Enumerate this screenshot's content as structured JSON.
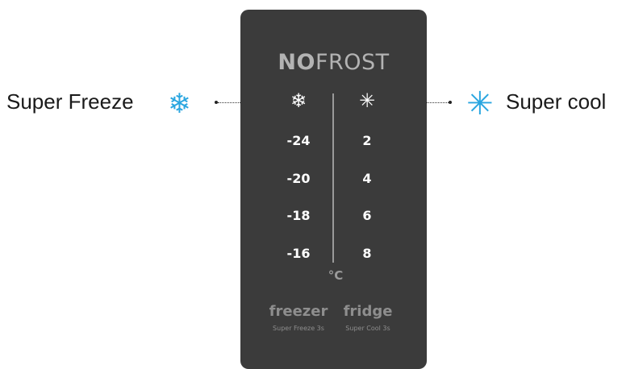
{
  "brand": {
    "bold": "NO",
    "light": "FROST"
  },
  "freezer": {
    "temps": [
      "-24",
      "-20",
      "-18",
      "-16"
    ],
    "name": "freezer",
    "sub": "Super Freeze 3s"
  },
  "fridge": {
    "temps": [
      "2",
      "4",
      "6",
      "8"
    ],
    "name": "fridge",
    "sub": "Super Cool 3s"
  },
  "unit": "°C",
  "callouts": {
    "left": "Super Freeze",
    "right": "Super cool"
  },
  "icons": {
    "freezer_snowflake": "snowflake-icon",
    "fridge_asterisk": "asterisk-icon",
    "accent_color": "#2aa6e0"
  }
}
